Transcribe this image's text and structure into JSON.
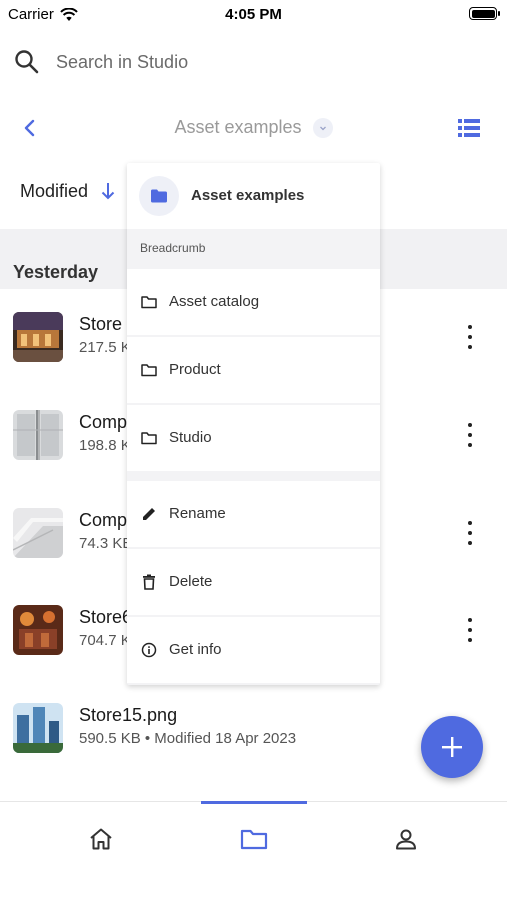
{
  "status_bar": {
    "carrier": "Carrier",
    "time": "4:05 PM"
  },
  "search": {
    "placeholder": "Search in Studio"
  },
  "nav": {
    "title": "Asset examples"
  },
  "sort": {
    "label": "Modified"
  },
  "section": {
    "title": "Yesterday"
  },
  "files": [
    {
      "name": "Store",
      "meta": "217.5 K"
    },
    {
      "name": "Comp",
      "meta": "198.8 K"
    },
    {
      "name": "Comp",
      "meta": "74.3 KE"
    },
    {
      "name": "Store6",
      "meta": "704.7 K"
    },
    {
      "name": "Store15.png",
      "meta": "590.5 KB • Modified 18 Apr 2023"
    }
  ],
  "popup": {
    "title": "Asset examples",
    "breadcrumb_label": "Breadcrumb",
    "breadcrumb": [
      {
        "label": "Asset catalog",
        "icon": "folder-icon"
      },
      {
        "label": "Product",
        "icon": "folder-icon"
      },
      {
        "label": "Studio",
        "icon": "folder-icon"
      }
    ],
    "actions": [
      {
        "label": "Rename",
        "icon": "pencil-icon"
      },
      {
        "label": "Delete",
        "icon": "trash-icon"
      },
      {
        "label": "Get info",
        "icon": "info-icon"
      }
    ]
  },
  "tabs": [
    {
      "icon": "home-icon"
    },
    {
      "icon": "folder-icon",
      "active": true
    },
    {
      "icon": "person-icon"
    }
  ],
  "colors": {
    "accent": "#4f6ae0",
    "band": "#f1f1f3",
    "popup_bg": "#f3f3f5"
  }
}
